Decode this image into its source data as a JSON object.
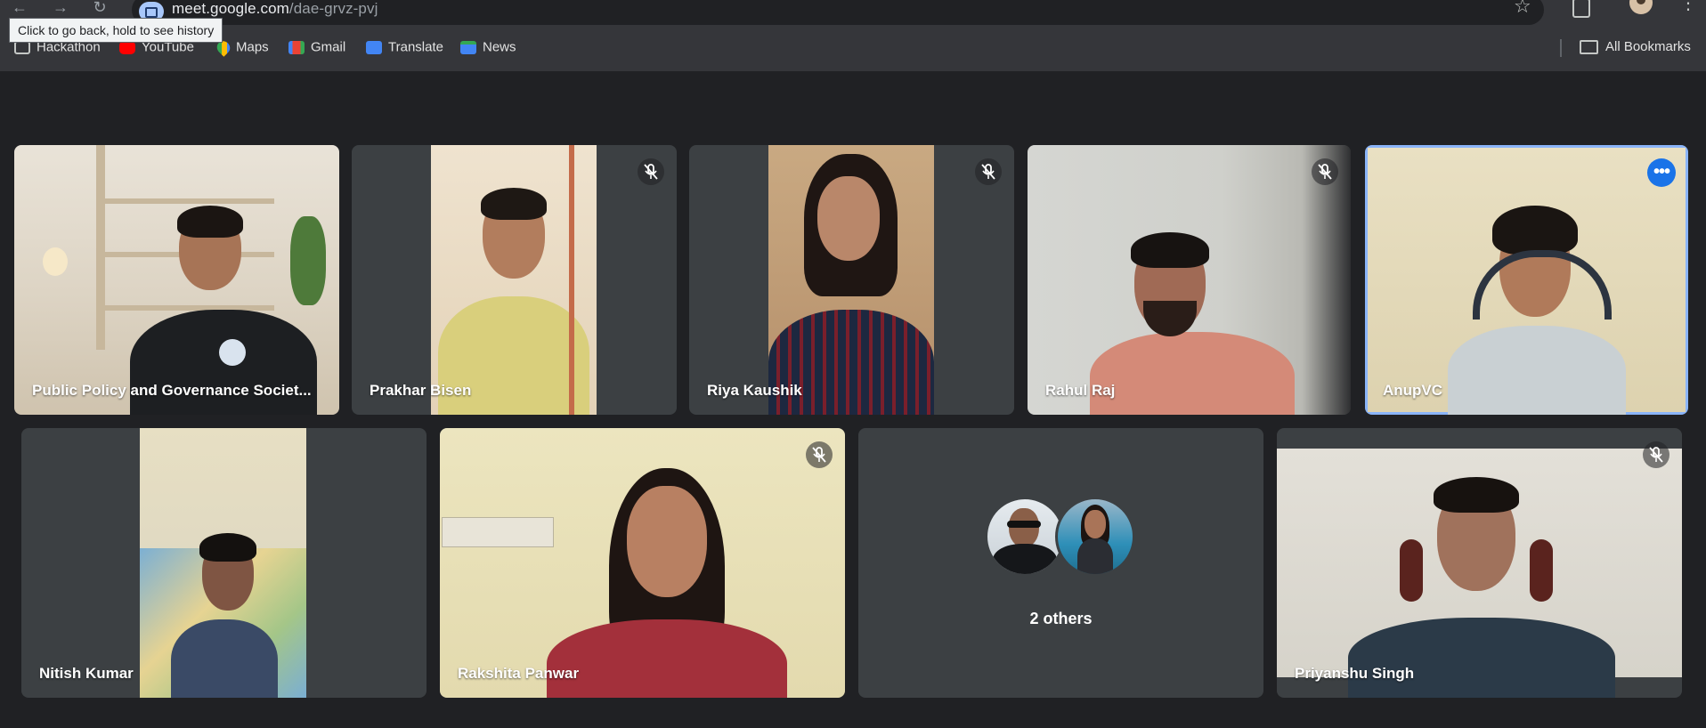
{
  "browser": {
    "url_host": "meet.google.com",
    "url_path": "/dae-grvz-pvj",
    "tooltip": "Click to go back, hold to see history"
  },
  "bookmarks": {
    "items": [
      {
        "label": "Hackathon",
        "icon": "folder-icon"
      },
      {
        "label": "YouTube",
        "icon": "youtube-icon"
      },
      {
        "label": "Maps",
        "icon": "maps-icon"
      },
      {
        "label": "Gmail",
        "icon": "gmail-icon"
      },
      {
        "label": "Translate",
        "icon": "translate-icon"
      },
      {
        "label": "News",
        "icon": "news-icon"
      }
    ],
    "all_bookmarks": "All Bookmarks"
  },
  "participants": [
    {
      "name": "Public Policy and Governance Societ...",
      "muted": false
    },
    {
      "name": "Prakhar Bisen",
      "muted": true
    },
    {
      "name": "Riya Kaushik",
      "muted": true
    },
    {
      "name": "Rahul Raj",
      "muted": true
    },
    {
      "name": "AnupVC",
      "muted": false,
      "active_speaker": true
    },
    {
      "name": "Nitish Kumar",
      "muted": false
    },
    {
      "name": "Rakshita Panwar",
      "muted": true
    },
    {
      "name": "Priyanshu Singh",
      "muted": true
    }
  ],
  "others": {
    "label": "2 others"
  },
  "colors": {
    "background": "#202124",
    "tile": "#3c4043",
    "accent": "#8ab4f8",
    "more_button": "#1a73e8"
  }
}
